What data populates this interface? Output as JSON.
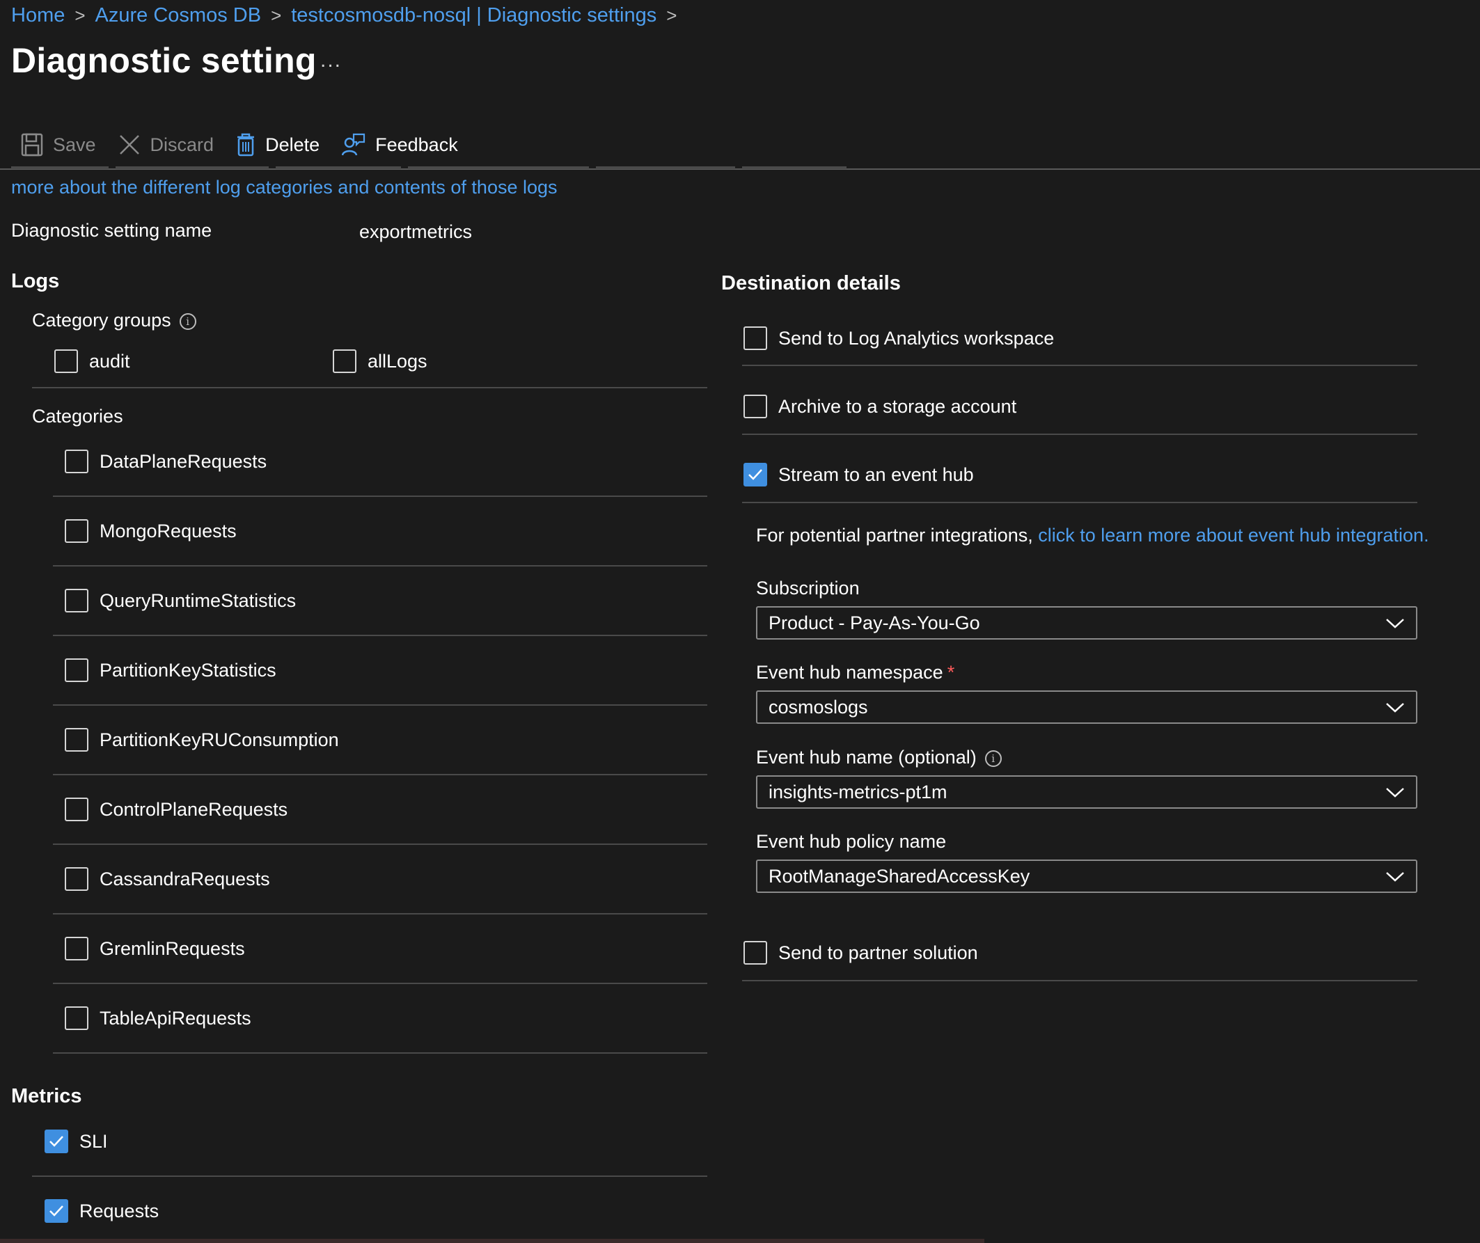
{
  "breadcrumb": {
    "home": "Home",
    "cosmos": "Azure Cosmos DB",
    "resource": "testcosmosdb-nosql | Diagnostic settings"
  },
  "page": {
    "title": "Diagnostic setting",
    "more": "..."
  },
  "toolbar": {
    "save": "Save",
    "discard": "Discard",
    "delete": "Delete",
    "feedback": "Feedback"
  },
  "intro": {
    "link": "more about the different log categories and contents of those logs"
  },
  "setting": {
    "label": "Diagnostic setting name",
    "value": "exportmetrics"
  },
  "logs": {
    "title": "Logs",
    "category_groups_label": "Category groups",
    "groups": [
      {
        "label": "audit",
        "checked": false
      },
      {
        "label": "allLogs",
        "checked": false
      }
    ],
    "categories_label": "Categories",
    "categories": [
      {
        "label": "DataPlaneRequests",
        "checked": false
      },
      {
        "label": "MongoRequests",
        "checked": false
      },
      {
        "label": "QueryRuntimeStatistics",
        "checked": false
      },
      {
        "label": "PartitionKeyStatistics",
        "checked": false
      },
      {
        "label": "PartitionKeyRUConsumption",
        "checked": false
      },
      {
        "label": "ControlPlaneRequests",
        "checked": false
      },
      {
        "label": "CassandraRequests",
        "checked": false
      },
      {
        "label": "GremlinRequests",
        "checked": false
      },
      {
        "label": "TableApiRequests",
        "checked": false
      }
    ]
  },
  "metrics": {
    "title": "Metrics",
    "items": [
      {
        "label": "SLI",
        "checked": true
      },
      {
        "label": "Requests",
        "checked": true
      }
    ]
  },
  "destination": {
    "title": "Destination details",
    "options": [
      {
        "label": "Send to Log Analytics workspace",
        "checked": false
      },
      {
        "label": "Archive to a storage account",
        "checked": false
      },
      {
        "label": "Stream to an event hub",
        "checked": true
      },
      {
        "label": "Send to partner solution",
        "checked": false
      }
    ],
    "partner_text": "For potential partner integrations, ",
    "partner_link": "click to learn more about event hub integration.",
    "subscription_label": "Subscription",
    "subscription_value": "Product - Pay-As-You-Go",
    "namespace_label": "Event hub namespace",
    "namespace_required": "*",
    "namespace_value": "cosmoslogs",
    "hubname_label": "Event hub name (optional)",
    "hubname_value": "insights-metrics-pt1m",
    "policy_label": "Event hub policy name",
    "policy_value": "RootManageSharedAccessKey"
  },
  "colors": {
    "background": "#1b1b1b",
    "link": "#4f9fee",
    "checked": "#3f8fe0",
    "required": "#ff5b5b"
  }
}
